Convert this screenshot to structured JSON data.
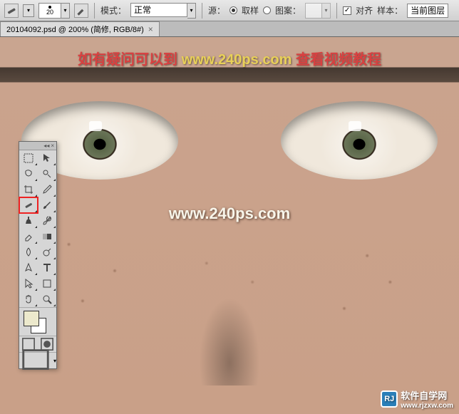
{
  "optionsBar": {
    "brushSize": "20",
    "modeLabel": "模式：",
    "modeValue": "正常",
    "sourceLabel": "源：",
    "sourceSampled": "取样",
    "sourcePattern": "图案：",
    "alignedLabel": "对齐",
    "sampleLabel": "样本：",
    "sampleValue": "当前图层"
  },
  "tab": {
    "title": "20104092.psd @ 200% (简修, RGB/8#)"
  },
  "overlay": {
    "part1": "如有疑问可以到",
    "url": "www.240ps.com",
    "part2": "查看视频教程",
    "centerUrl": "www.240ps.com"
  },
  "watermark": {
    "logo": "RJ",
    "text1": "软件自学网",
    "text2": "www.rjzxw.com"
  },
  "tools": {
    "names": [
      "marquee-tool",
      "move-tool",
      "lasso-tool",
      "quick-select-tool",
      "crop-tool",
      "eyedropper-tool",
      "healing-brush-tool",
      "brush-tool",
      "clone-stamp-tool",
      "history-brush-tool",
      "eraser-tool",
      "gradient-tool",
      "blur-tool",
      "dodge-tool",
      "pen-tool",
      "type-tool",
      "path-select-tool",
      "shape-tool",
      "hand-tool",
      "zoom-tool"
    ],
    "highlightedIndex": 6
  }
}
